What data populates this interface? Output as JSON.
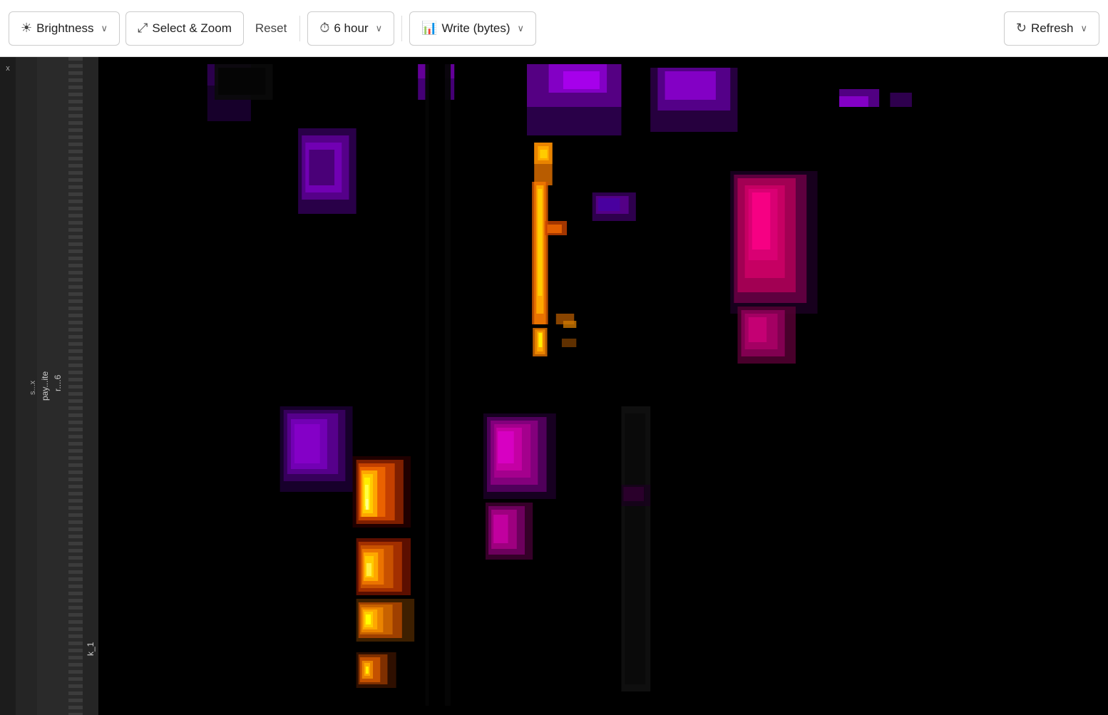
{
  "toolbar": {
    "brightness_label": "Brightness",
    "select_zoom_label": "Select & Zoom",
    "reset_label": "Reset",
    "time_label": "6 hour",
    "metric_label": "Write (bytes)",
    "refresh_label": "Refresh",
    "brightness_icon": "☀",
    "select_zoom_icon": "⤢",
    "time_icon": "⏱",
    "metric_icon": "📊",
    "refresh_icon": "↻",
    "chevron": "∨"
  },
  "sidebar": {
    "label_x": "x",
    "label_s": "s...x",
    "label_pay": "pay...ite",
    "label_r": "r....6",
    "label_k": "k_1"
  },
  "heatmap": {
    "description": "Heatmap visualization showing write bytes data over 6 hours"
  }
}
